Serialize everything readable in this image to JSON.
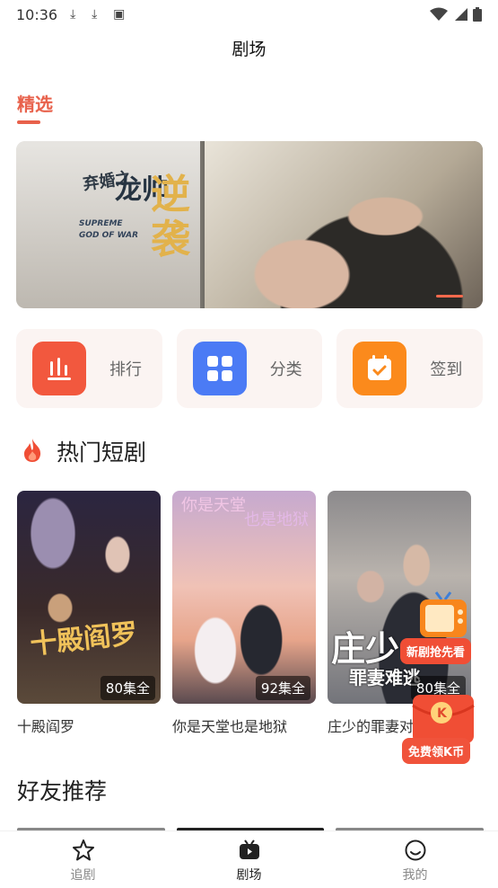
{
  "status_bar": {
    "time": "10:36",
    "icons": [
      "download-icon",
      "download-icon",
      "keyboard-icon",
      "wifi-icon",
      "signal-icon",
      "battery-icon"
    ]
  },
  "header": {
    "title": "剧场"
  },
  "tabs": {
    "selected": "精选"
  },
  "banner": {
    "art_lines": [
      "弃",
      "婚",
      "之",
      "龙",
      "帅",
      "逆",
      "袭"
    ],
    "art_en": "SUPREME GOD OF WAR",
    "slides_indicator": "active"
  },
  "quick_actions": [
    {
      "label": "排行",
      "icon": "ranking-icon",
      "color": "#f2583e"
    },
    {
      "label": "分类",
      "icon": "category-icon",
      "color": "#4b7bf5"
    },
    {
      "label": "签到",
      "icon": "checkin-calendar-icon",
      "color": "#fb8a1c"
    }
  ],
  "hot_section": {
    "title": "热门短剧",
    "icon": "fire-icon"
  },
  "hot_dramas": [
    {
      "name": "十殿阎罗",
      "count": "80集全",
      "poster_text": "十殿阎罗"
    },
    {
      "name": "你是天堂也是地狱",
      "count": "92集全",
      "poster_text_a": "你是天堂",
      "poster_text_b": "也是地狱"
    },
    {
      "name": "庄少的罪妻对",
      "count": "80集全",
      "poster_text_a": "庄少",
      "poster_text_b": "罪妻难逃"
    }
  ],
  "promo": {
    "top_label": "新剧抢先看",
    "bottom_label": "免费领K币",
    "coin_letter": "K"
  },
  "friends_section": {
    "title": "好友推荐"
  },
  "bottom_nav": [
    {
      "label": "追剧",
      "icon": "star-icon",
      "active": false
    },
    {
      "label": "剧场",
      "icon": "tv-icon",
      "active": true
    },
    {
      "label": "我的",
      "icon": "profile-icon",
      "active": false
    }
  ],
  "colors": {
    "accent": "#e8614b",
    "tab_text": "#e8614b",
    "text": "#222222",
    "muted": "#888888"
  }
}
